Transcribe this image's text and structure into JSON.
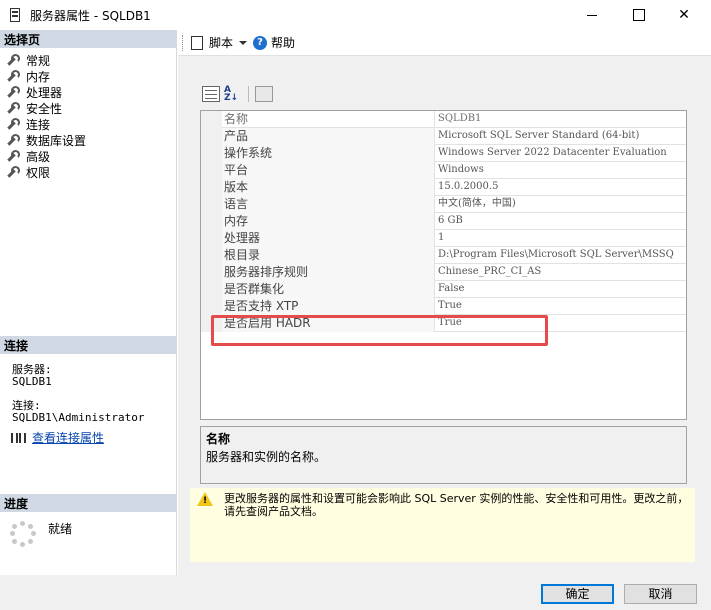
{
  "window": {
    "title": "服务器属性 - SQLDB1",
    "minimize": "—",
    "maximize": "☐",
    "close": "✕"
  },
  "left_panel": {
    "select_page_header": "选择页",
    "pages": [
      {
        "label": "常规"
      },
      {
        "label": "内存"
      },
      {
        "label": "处理器"
      },
      {
        "label": "安全性"
      },
      {
        "label": "连接"
      },
      {
        "label": "数据库设置"
      },
      {
        "label": "高级"
      },
      {
        "label": "权限"
      }
    ],
    "connection_header": "连接",
    "server_label": "服务器:",
    "server_value": "SQLDB1",
    "connection_label": "连接:",
    "connection_value": "SQLDB1\\Administrator",
    "view_connection_link": "查看连接属性",
    "progress_header": "进度",
    "progress_status": "就绪"
  },
  "toolbar": {
    "script_label": "脚本",
    "help_label": "帮助"
  },
  "grid": {
    "rows": [
      {
        "name": "名称",
        "value": "SQLDB1"
      },
      {
        "name": "产品",
        "value": "Microsoft SQL Server Standard (64-bit)"
      },
      {
        "name": "操作系统",
        "value": "Windows Server 2022 Datacenter Evaluation"
      },
      {
        "name": "平台",
        "value": "Windows"
      },
      {
        "name": "版本",
        "value": "15.0.2000.5"
      },
      {
        "name": "语言",
        "value": "中文(简体，中国)"
      },
      {
        "name": "内存",
        "value": "6 GB"
      },
      {
        "name": "处理器",
        "value": "1"
      },
      {
        "name": "根目录",
        "value": "D:\\Program Files\\Microsoft SQL Server\\MSSQ"
      },
      {
        "name": "服务器排序规则",
        "value": "Chinese_PRC_CI_AS"
      },
      {
        "name": "是否群集化",
        "value": "False"
      },
      {
        "name": "是否支持 XTP",
        "value": "True"
      },
      {
        "name": "是否启用 HADR",
        "value": "True"
      }
    ]
  },
  "description": {
    "title": "名称",
    "text": "服务器和实例的名称。"
  },
  "warning": {
    "text": "更改服务器的属性和设置可能会影响此 SQL Server 实例的性能、安全性和可用性。更改之前，请先查阅产品文档。"
  },
  "buttons": {
    "ok": "确定",
    "cancel": "取消"
  },
  "colors": {
    "section_header": "#cfd8e3",
    "highlight_border": "#e64b4b",
    "warning_background": "#fffee0",
    "link": "#0645ad"
  }
}
